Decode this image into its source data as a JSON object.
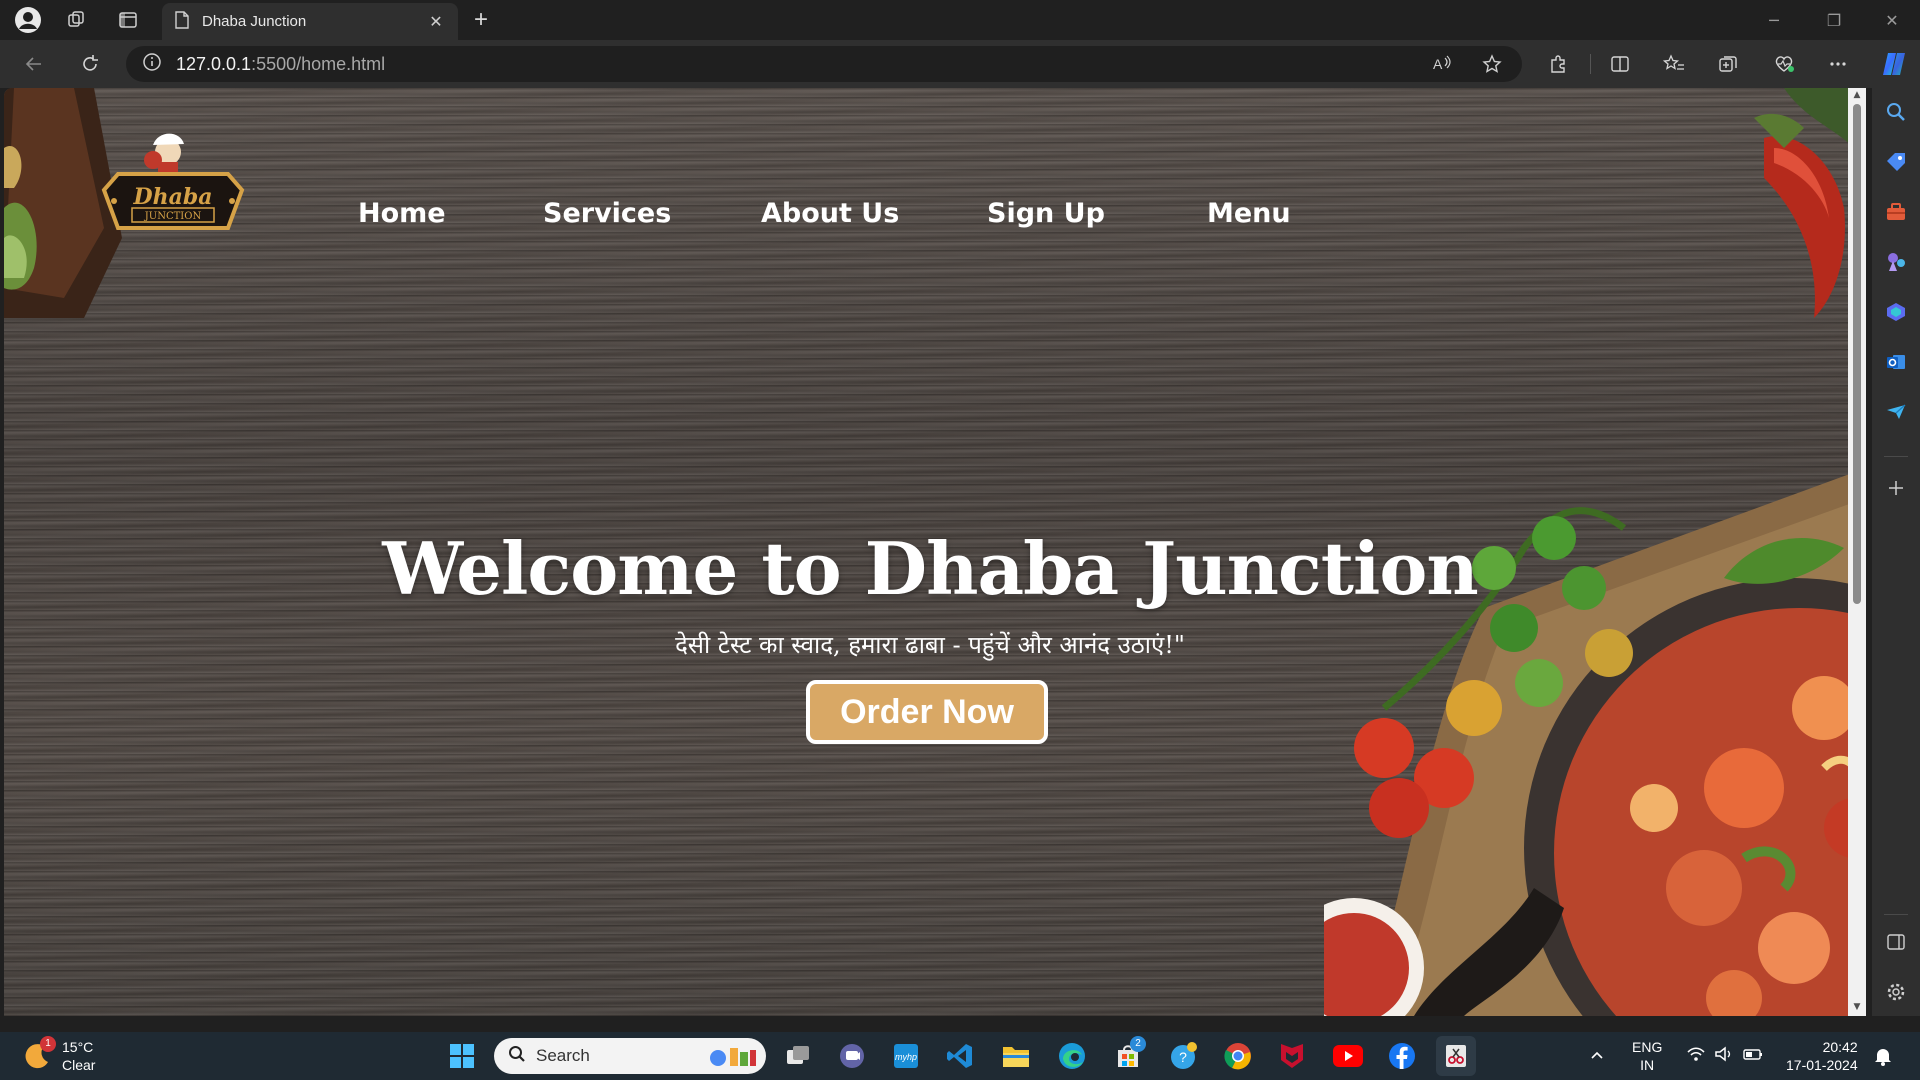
{
  "browser": {
    "tab_title": "Dhaba Junction",
    "url_host": "127.0.0.1",
    "url_path": ":5500/home.html"
  },
  "page": {
    "logo_text": "Dhaba",
    "logo_subtext": "JUNCTION",
    "nav": [
      "Home",
      "Services",
      "About Us",
      "Sign Up",
      "Menu"
    ],
    "hero_title": "Welcome to Dhaba Junction",
    "hero_subtitle": "देसी टेस्ट का स्वाद, हमारा ढाबा - पहुंचें और आनंद उठाएं!\"",
    "order_button": "Order Now",
    "accent_color": "#d9a865"
  },
  "taskbar": {
    "weather_temp": "15°C",
    "weather_cond": "Clear",
    "weather_badge": "1",
    "search_label": "Search",
    "store_badge": "2",
    "lang_line1": "ENG",
    "lang_line2": "IN",
    "time": "20:42",
    "date": "17-01-2024"
  }
}
